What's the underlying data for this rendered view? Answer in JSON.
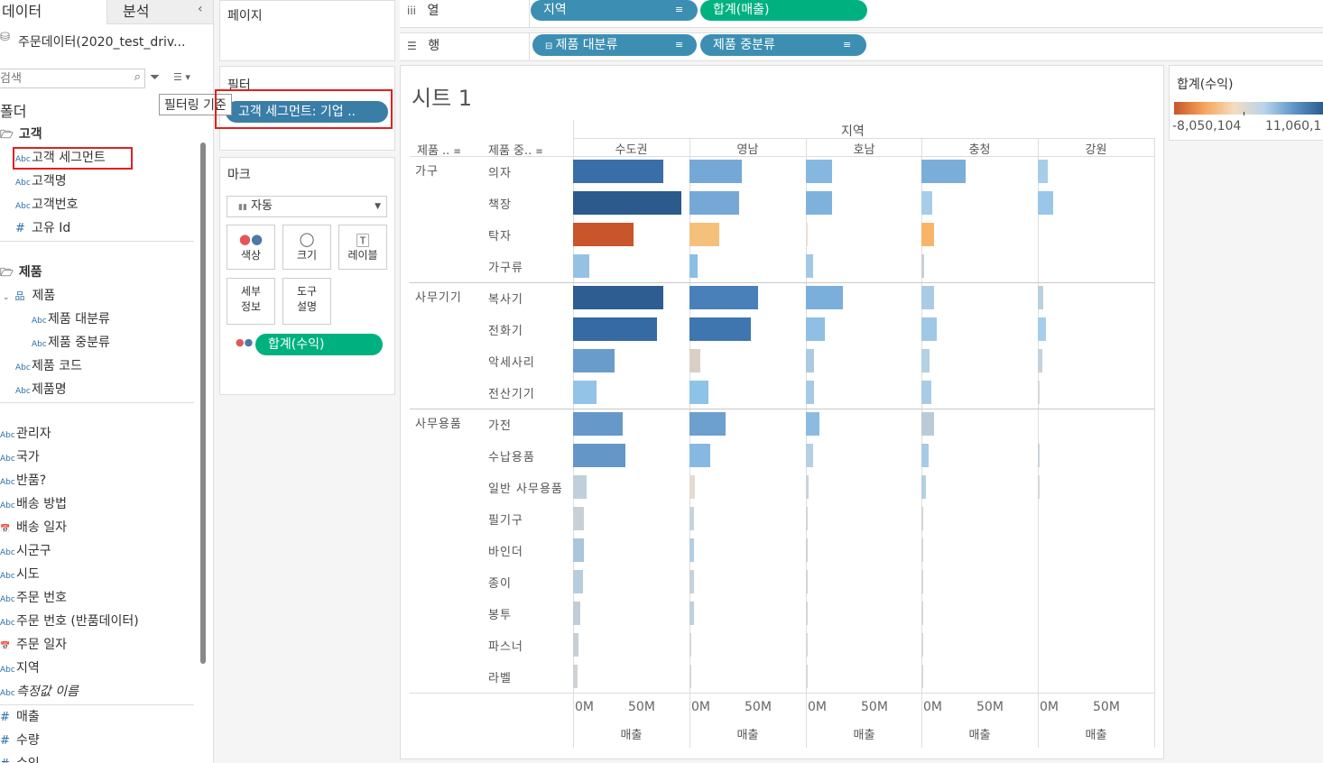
{
  "left_pane": {
    "tabs": [
      "데이터",
      "분석"
    ],
    "collapse_icon": "chevron-left-icon",
    "datasource": "주문데이터(2020_test_driv...",
    "search_placeholder": "검색",
    "folder_header": "폴더",
    "groups": [
      {
        "name": "고객",
        "fields": [
          {
            "type": "Abc",
            "name": "고객 세그먼트",
            "highlight": true
          },
          {
            "type": "Abc",
            "name": "고객명"
          },
          {
            "type": "Abc",
            "name": "고객번호"
          },
          {
            "type": "#",
            "name": "고유 Id"
          }
        ]
      },
      {
        "name": "제품",
        "hierarchy": "제품",
        "fields": [
          {
            "type": "Abc",
            "name": "제품 대분류"
          },
          {
            "type": "Abc",
            "name": "제품 중분류"
          },
          {
            "type": "Abc",
            "name": "제품 코드"
          },
          {
            "type": "Abc",
            "name": "제품명"
          }
        ]
      }
    ],
    "dimensions": [
      {
        "type": "Abc",
        "name": "관리자"
      },
      {
        "type": "Abc",
        "name": "국가"
      },
      {
        "type": "Abc",
        "name": "반품?"
      },
      {
        "type": "Abc",
        "name": "배송 방법"
      },
      {
        "type": "date",
        "name": "배송 일자"
      },
      {
        "type": "Abc",
        "name": "시군구"
      },
      {
        "type": "Abc",
        "name": "시도"
      },
      {
        "type": "Abc",
        "name": "주문 번호"
      },
      {
        "type": "Abc",
        "name": "주문 번호 (반품데이터)"
      },
      {
        "type": "date",
        "name": "주문 일자"
      },
      {
        "type": "Abc",
        "name": "지역"
      },
      {
        "type": "Abc",
        "name": "측정값 이름",
        "italic": true
      }
    ],
    "measures": [
      {
        "type": "#",
        "name": "매출"
      },
      {
        "type": "#",
        "name": "수량"
      },
      {
        "type": "#",
        "name": "수익"
      }
    ]
  },
  "pages_label": "페이지",
  "filters": {
    "title": "필터",
    "pill": "고객 세그먼트: 기업 ..",
    "tooltip": "필터링 기준"
  },
  "marks": {
    "title": "마크",
    "type": "자동",
    "buttons": [
      "색상",
      "크기",
      "레이블",
      "세부\n정보",
      "도구\n설명"
    ],
    "color_pill": "합계(수익)"
  },
  "shelves": {
    "columns_label": "열",
    "rows_label": "행",
    "columns_pills": [
      "지역",
      "합계(매출)"
    ],
    "rows_pills": [
      "제품 대분류",
      "제품 중분류"
    ]
  },
  "legend": {
    "title": "합계(수익)",
    "min": "-8,050,104",
    "max": "11,060,1"
  },
  "sheet": {
    "title": "시트 1",
    "col_header_title": "지역",
    "row_headers": [
      "제품 ..",
      "제품 중.."
    ],
    "x_axis_title": "매출",
    "x_ticks": [
      "0M",
      "50M"
    ],
    "regions": [
      "수도권",
      "영남",
      "호남",
      "충청",
      "강원"
    ]
  },
  "chart_data": {
    "type": "bar",
    "orientation": "horizontal",
    "x_unit": "M",
    "xlim": [
      0,
      85
    ],
    "color_measure": "합계(수익)",
    "color_range": [
      -8050104,
      11060100
    ],
    "categories": [
      {
        "group": "가구",
        "items": [
          "의자",
          "책장",
          "탁자",
          "가구류"
        ]
      },
      {
        "group": "사무기기",
        "items": [
          "복사기",
          "전화기",
          "악세사리",
          "전산기기"
        ]
      },
      {
        "group": "사무용품",
        "items": [
          "가전",
          "수납용품",
          "일반 사무용품",
          "필기구",
          "바인더",
          "종이",
          "봉투",
          "파스너",
          "라벨"
        ]
      }
    ],
    "series": [
      {
        "name": "수도권",
        "values": [
          66,
          79,
          44,
          12,
          66,
          61,
          30,
          17,
          36,
          38,
          10,
          8,
          8,
          7,
          5,
          4,
          3
        ],
        "colors": [
          "#3a6ea8",
          "#2c5a8c",
          "#c9552a",
          "#95c2e3",
          "#2e5d92",
          "#356aa3",
          "#6a9ccb",
          "#93c3e6",
          "#6699c9",
          "#6497c8",
          "#bfd0dc",
          "#c8d0d6",
          "#a9c6dc",
          "#b9ccdb",
          "#c0cdd7",
          "#c8cfd5",
          "#cfd3d6"
        ]
      },
      {
        "name": "영남",
        "values": [
          38,
          36,
          22,
          6,
          50,
          45,
          8,
          14,
          26,
          15,
          4,
          3,
          3,
          3,
          3,
          1,
          1
        ],
        "colors": [
          "#76a8d7",
          "#76a8d7",
          "#f5c07a",
          "#8cbee5",
          "#4a80b9",
          "#3f76b0",
          "#d8cfc5",
          "#8ec2e6",
          "#6d9fcf",
          "#86b8e2",
          "#e3dbd3",
          "#c7d4de",
          "#b5cde0",
          "#c4d2dd",
          "#bfcfdc",
          "#d4d6d8",
          "#d7d7d7"
        ]
      },
      {
        "name": "호남",
        "values": [
          19,
          19,
          1,
          5,
          27,
          14,
          6,
          6,
          10,
          5,
          2,
          1,
          1,
          1,
          1,
          1,
          1
        ],
        "colors": [
          "#86b7e0",
          "#7fb1dd",
          "#e8dfd6",
          "#a3c8e6",
          "#7aaedb",
          "#8fbfe4",
          "#aacbe2",
          "#a6cae4",
          "#8cbbe1",
          "#b4d0e4",
          "#c9d3da",
          "#d2d5d7",
          "#cdd3d8",
          "#d2d5d7",
          "#d4d6d8",
          "#d7d7d7",
          "#d7d7d7"
        ]
      },
      {
        "name": "충청",
        "values": [
          32,
          8,
          9,
          2,
          9,
          11,
          6,
          7,
          9,
          5,
          3,
          1,
          1,
          1,
          1,
          1,
          1
        ],
        "colors": [
          "#7aaed9",
          "#a6cde9",
          "#f8b569",
          "#c8d0d6",
          "#a9cbe3",
          "#9fc7e6",
          "#b4d0e3",
          "#a9cbe3",
          "#b9ccd6",
          "#a9cbe3",
          "#b6cfe1",
          "#cfd4d8",
          "#d2d5d7",
          "#d4d6d8",
          "#d4d6d8",
          "#d7d7d7",
          "#d7d7d7"
        ]
      },
      {
        "name": "강원",
        "values": [
          7,
          11,
          0,
          0,
          4,
          6,
          3,
          1,
          0,
          1,
          1,
          0,
          0,
          0,
          0,
          0,
          0
        ],
        "colors": [
          "#a6cde9",
          "#9ac6e8",
          "#ffffff",
          "#ffffff",
          "#b9d0de",
          "#a6cde9",
          "#c4d2dd",
          "#d4d6d8",
          "#ffffff",
          "#c8d3db",
          "#d7d7d7",
          "#ffffff",
          "#ffffff",
          "#ffffff",
          "#ffffff",
          "#ffffff",
          "#ffffff"
        ]
      }
    ]
  }
}
